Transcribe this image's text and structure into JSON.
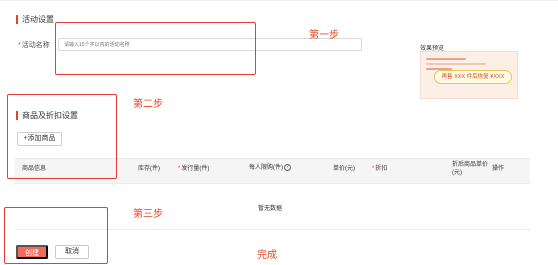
{
  "activity_settings": {
    "section_title": "活动设置",
    "name_label": "活动名称",
    "name_required_mark": "*",
    "name_placeholder": "请输入15个字以内的活动名称"
  },
  "preview": {
    "label": "效果预览",
    "pill_text": "再售 XXX 件后恢复 ¥XXX",
    "accent_color": "#e8431e",
    "pill_border_color": "#e8c45a"
  },
  "product_settings": {
    "section_title": "商品及折扣设置",
    "add_product_label": "+添加商品"
  },
  "table": {
    "headers": [
      {
        "text": "商品信息",
        "required": false
      },
      {
        "text": "库存(件)",
        "required": false
      },
      {
        "text": "发行量(件)",
        "required": true
      },
      {
        "text": "每人限购(件)",
        "required": false,
        "help_icon": "question-circle-icon"
      },
      {
        "text": "单价(元)",
        "required": false
      },
      {
        "text": "折扣",
        "required": true
      },
      {
        "text": "折后商品单价(元)",
        "required": false
      },
      {
        "text": "操作",
        "required": false
      }
    ],
    "required_mark": "*",
    "empty_text": "暂无数据"
  },
  "footer": {
    "create_label": "创建",
    "cancel_label": "取消",
    "create_color": "#f26a5a"
  },
  "annotations": {
    "step1": "第一步",
    "step2": "第二步",
    "step3": "第三步",
    "done": "完成",
    "color": "#e83a3a"
  }
}
